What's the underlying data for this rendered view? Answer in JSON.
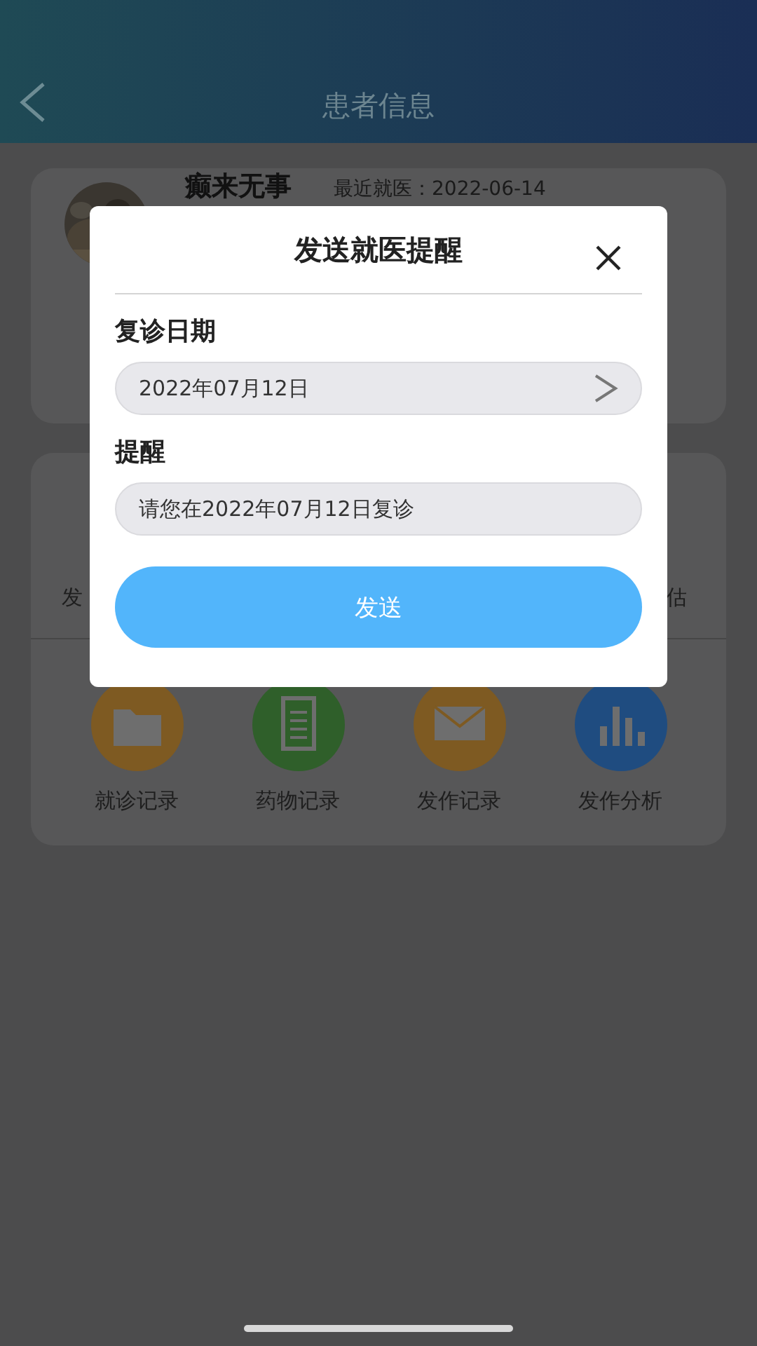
{
  "header": {
    "title": "患者信息"
  },
  "patient": {
    "name": "癫来无事",
    "last_visit": "最近就医：2022-06-14"
  },
  "actions_partial": [
    {
      "label": "发"
    },
    {
      "label": "估"
    }
  ],
  "shortcuts": [
    {
      "label": "就诊记录",
      "kind": "folder"
    },
    {
      "label": "药物记录",
      "kind": "document"
    },
    {
      "label": "发作记录",
      "kind": "envelope"
    },
    {
      "label": "发作分析",
      "kind": "chart"
    }
  ],
  "dialog": {
    "title": "发送就医提醒",
    "date_label": "复诊日期",
    "date_value": "2022年07月12日",
    "reminder_label": "提醒",
    "reminder_value": "请您在2022年07月12日复诊",
    "send_button": "发送"
  }
}
